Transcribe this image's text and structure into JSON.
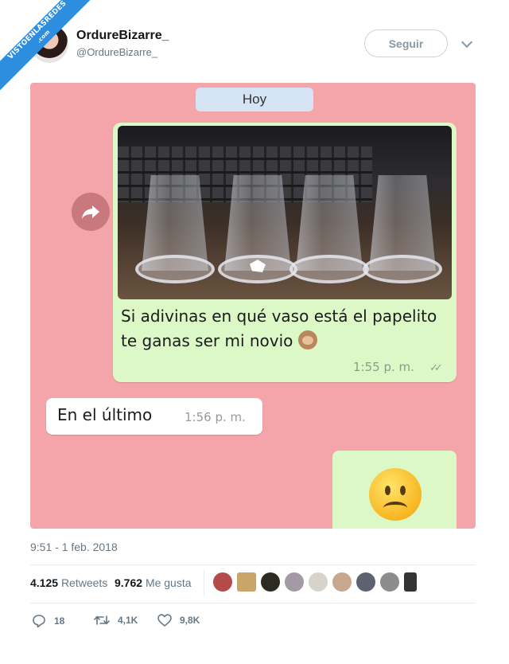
{
  "watermark": {
    "line1": "VISTOENLASREDES",
    "line2": ".com"
  },
  "author": {
    "display_name": "OrdureBizarre_",
    "handle": "@OrdureBizarre_"
  },
  "follow_label": "Seguir",
  "chat": {
    "date_chip": "Hoy",
    "sent_message": "Si adivinas en qué vaso está el papelito te ganas ser mi novio",
    "sent_time": "1:55 p. m.",
    "read_ticks": "✓✓",
    "received_message": "En el último",
    "received_time": "1:56 p. m."
  },
  "tweet_timestamp": "9:51 - 1 feb. 2018",
  "stats": {
    "retweets_count": "4.125",
    "retweets_label": "Retweets",
    "likes_count": "9.762",
    "likes_label": "Me gusta"
  },
  "actions": {
    "replies": "18",
    "retweets": "4,1K",
    "likes": "9,8K"
  },
  "icons": [
    "forward-icon",
    "monkey-emoji",
    "sad-face-emoji",
    "reply-icon",
    "retweet-icon",
    "like-icon",
    "chevron-down-icon"
  ],
  "colors": {
    "chat_background": "#f4a5aa",
    "sent_bubble": "#dcf8c6",
    "received_bubble": "#ffffff",
    "ribbon": "#2d8ee0"
  }
}
